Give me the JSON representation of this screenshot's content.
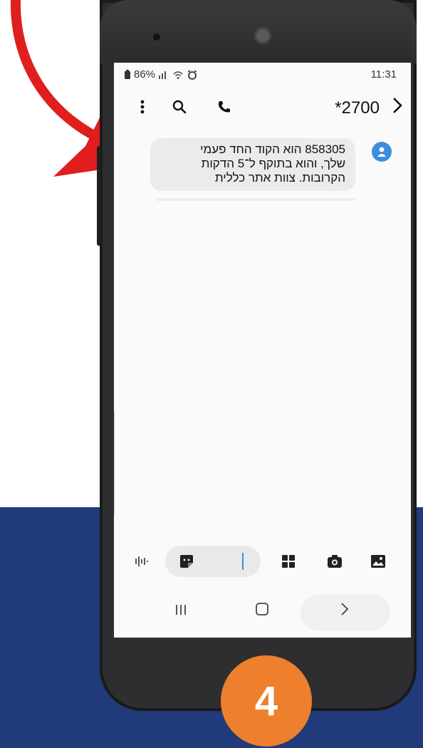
{
  "status_bar": {
    "battery": "86%",
    "time": "11:31"
  },
  "conversation": {
    "title": "*2700"
  },
  "message": {
    "lines": [
      "858305 הוא הקוד החד פעמי",
      "שלך, והוא בתוקף ל־5 הדקות",
      "הקרובות. צוות אתר כללית"
    ]
  },
  "step": {
    "number": "4"
  },
  "icons": {
    "menu": "more-vert-icon",
    "search": "search-icon",
    "call": "phone-icon",
    "back": "chevron-right-icon",
    "voice": "voice-wave-icon",
    "sticker": "sticker-icon",
    "apps": "grid-icon",
    "camera": "camera-icon",
    "gallery": "image-icon"
  },
  "colors": {
    "accent": "#3b8edb",
    "band": "#213a7a",
    "step": "#ee7f2d",
    "arrow": "#e01e1e"
  }
}
